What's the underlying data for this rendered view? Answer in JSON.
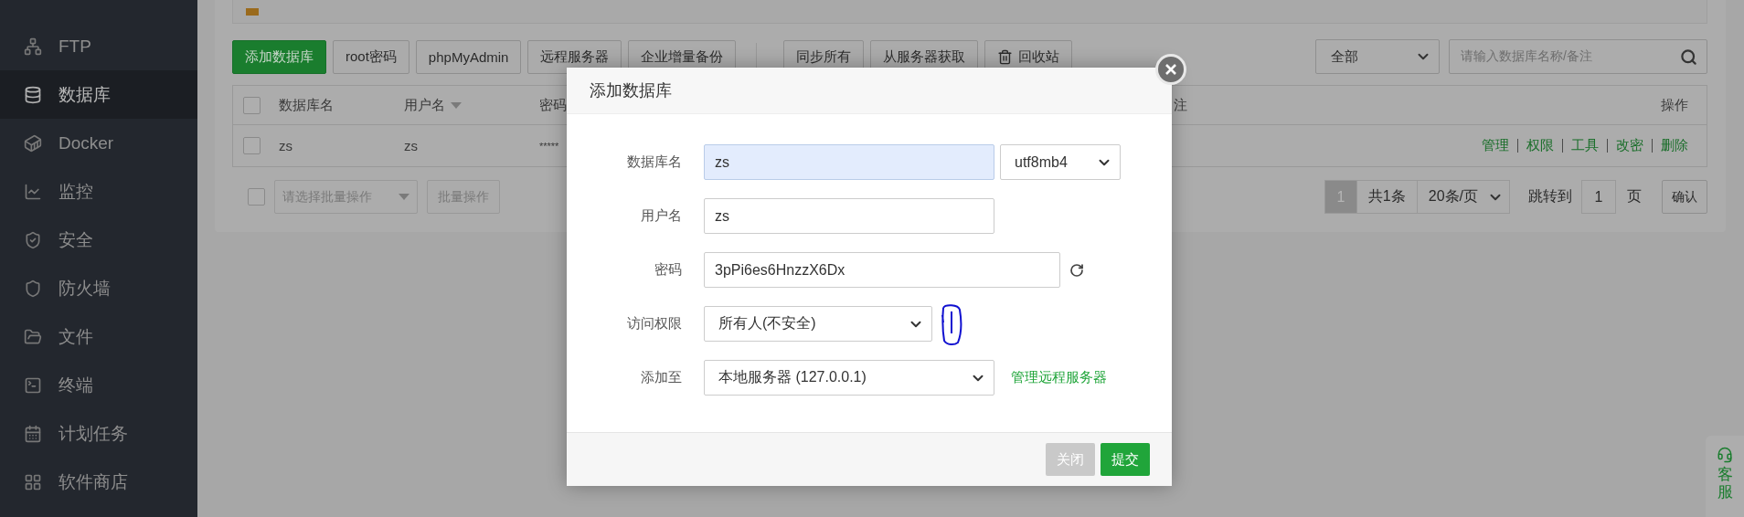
{
  "sidebar": {
    "items": [
      {
        "label": "FTP",
        "selected": false
      },
      {
        "label": "数据库",
        "selected": true
      },
      {
        "label": "Docker",
        "selected": false
      },
      {
        "label": "监控",
        "selected": false
      },
      {
        "label": "安全",
        "selected": false
      },
      {
        "label": "防火墙",
        "selected": false
      },
      {
        "label": "文件",
        "selected": false
      },
      {
        "label": "终端",
        "selected": false
      },
      {
        "label": "计划任务",
        "selected": false
      },
      {
        "label": "软件商店",
        "selected": false
      }
    ]
  },
  "toolbar": {
    "buttons": [
      {
        "label": "添加数据库",
        "kind": "primary"
      },
      {
        "label": "root密码",
        "kind": "default"
      },
      {
        "label": "phpMyAdmin",
        "kind": "default"
      },
      {
        "label": "远程服务器",
        "kind": "default"
      },
      {
        "label": "企业增量备份",
        "kind": "default"
      }
    ],
    "sync_buttons": [
      {
        "label": "同步所有",
        "kind": "default"
      },
      {
        "label": "从服务器获取",
        "kind": "default"
      },
      {
        "label": "回收站",
        "kind": "trash"
      }
    ],
    "filter": {
      "value": "全部"
    },
    "search": {
      "placeholder": "请输入数据库名称/备注"
    }
  },
  "table": {
    "header_checkbox": {
      "checked": false
    },
    "columns": [
      {
        "label": "数据库名",
        "kind": "plain"
      },
      {
        "label": "用户名",
        "kind": "sort"
      },
      {
        "label": "密码",
        "kind": "plain"
      },
      {
        "label": "注",
        "kind": "plain"
      },
      {
        "label": "操作",
        "kind": "plain"
      }
    ],
    "rows": [
      {
        "checked": false,
        "cells": [
          "zs",
          "zs",
          "*****"
        ],
        "actions": [
          "管理",
          "权限",
          "工具",
          "改密",
          "删除"
        ]
      }
    ]
  },
  "footer": {
    "checkbox": {
      "checked": false
    },
    "batch_select": {
      "placeholder": "请选择批量操作"
    },
    "batch_button": "批量操作",
    "pagination": {
      "pages": [
        {
          "label": "1",
          "selected": true
        }
      ],
      "total": "共1条",
      "page_size": "20条/页",
      "jump_label": "跳转到",
      "jump_value": "1",
      "page_unit": "页",
      "confirm": "确认"
    }
  },
  "modal": {
    "title": "添加数据库",
    "fields": [
      {
        "label": "数据库名",
        "kind": "text",
        "value": "zs",
        "focused": true,
        "extra": {
          "value": "utf8mb4"
        }
      },
      {
        "label": "用户名",
        "kind": "text",
        "value": "zs",
        "focused": false
      },
      {
        "label": "密码",
        "kind": "password",
        "value": "3pPi6es6HnzzX6Dx",
        "focused": false
      },
      {
        "label": "访问权限",
        "kind": "select",
        "value": "所有人(不安全)",
        "annotated": true
      },
      {
        "label": "添加至",
        "kind": "select",
        "value": "本地服务器 (127.0.0.1)",
        "link": "管理远程服务器"
      }
    ],
    "buttons": [
      {
        "label": "关闭",
        "kind": "secondary"
      },
      {
        "label": "提交",
        "kind": "primary"
      }
    ]
  },
  "service": {
    "label": "客服"
  }
}
